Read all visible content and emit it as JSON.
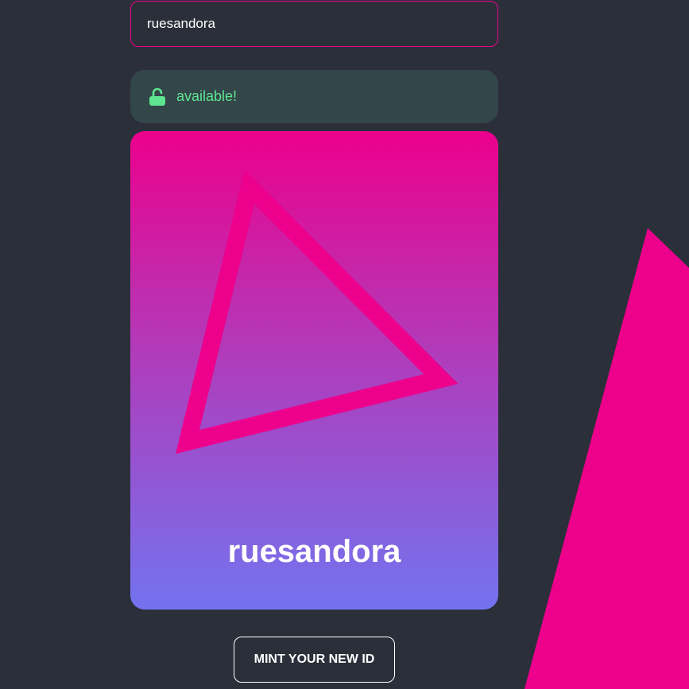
{
  "form": {
    "username_value": "ruesandora"
  },
  "status": {
    "text": "available!",
    "icon": "unlock-icon",
    "color": "#5ee58f"
  },
  "card": {
    "name": "ruesandora",
    "shape": "triangle-outline",
    "gradient_top": "#ec008c",
    "gradient_bottom": "#7373ef",
    "shape_color": "#ec008c"
  },
  "actions": {
    "mint_label": "MINT YOUR NEW ID"
  },
  "colors": {
    "background": "#2b2f3a",
    "accent": "#ec008c",
    "status_bg": "#33464a"
  }
}
